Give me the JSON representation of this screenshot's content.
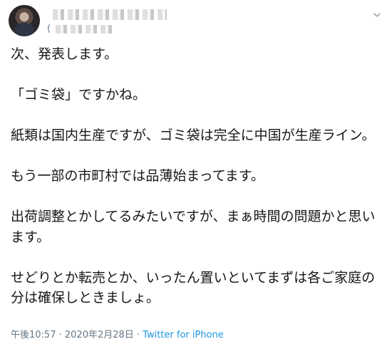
{
  "tweet": {
    "author": {
      "display_name_visible": "(",
      "screen_name_visible": "("
    },
    "icons": {
      "more": "chevron-down-icon"
    },
    "body": "次、発表します。\n\n「ゴミ袋」ですかね。\n\n紙類は国内生産ですが、ゴミ袋は完全に中国が生産ライン。\n\nもう一部の市町村では品薄始まってます。\n\n出荷調整とかしてるみたいですが、まぁ時間の問題かと思います。\n\nせどりとか転売とか、いったん置いといてまずは各ご家庭の分は確保しときましょ。",
    "time": "午後10:57",
    "separator": " · ",
    "date": "2020年2月28日",
    "source": "Twitter for iPhone"
  },
  "colors": {
    "text": "#14171a",
    "secondary": "#657786",
    "link": "#1b95e0"
  }
}
